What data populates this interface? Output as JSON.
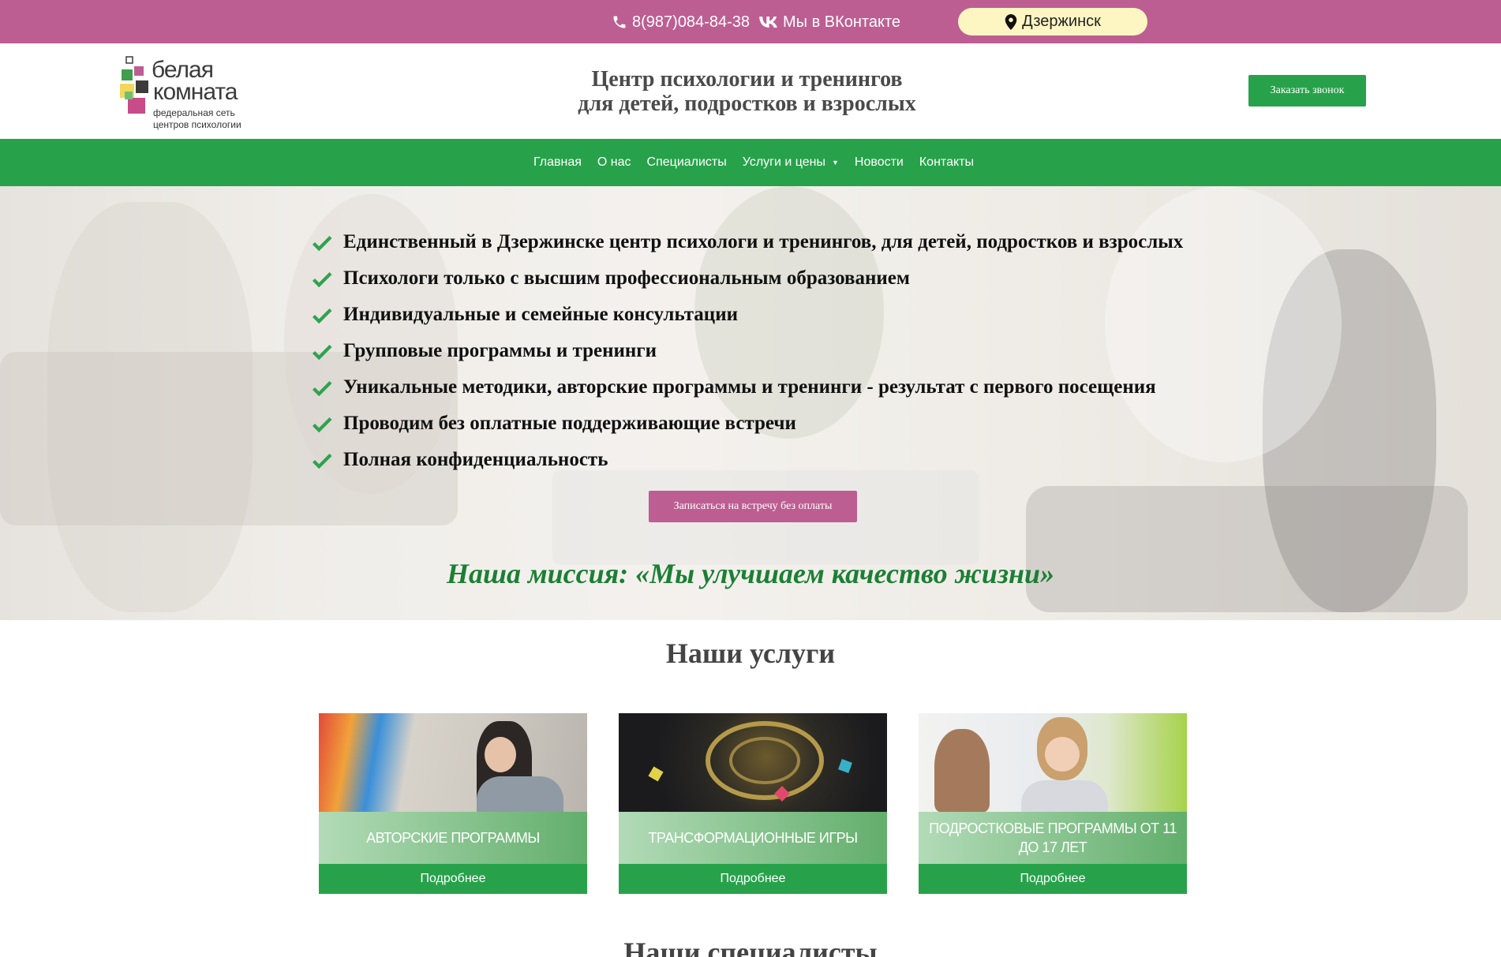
{
  "topbar": {
    "phone": "8(987)084-84-38",
    "vk_label": "Мы в ВКонтакте",
    "city": "Дзержинск",
    "icons": [
      "phone-icon",
      "vk-icon",
      "map-pin-icon"
    ]
  },
  "header": {
    "logo_line1": "белая",
    "logo_line2": "комната",
    "logo_sub1": "федеральная сеть",
    "logo_sub2": "центров психологии",
    "title_line1": "Центр психологии и тренингов",
    "title_line2": "для детей, подростков и взрослых",
    "call_button": "Заказать звонок"
  },
  "nav": {
    "items": [
      {
        "label": "Главная"
      },
      {
        "label": "О нас"
      },
      {
        "label": "Специалисты"
      },
      {
        "label": "Услуги и цены"
      },
      {
        "label": "Новости"
      },
      {
        "label": "Контакты"
      }
    ]
  },
  "hero": {
    "features": [
      "Единственный в Дзержинске центр психологи и тренингов, для детей, подростков и взрослых",
      "Психологи только с высшим профессиональным образованием",
      "Индивидуальные и семейные консультации",
      "Групповые программы и тренинги",
      "Уникальные методики, авторские программы и тренинги - результат с первого посещения",
      "Проводим без оплатные поддерживающие встречи",
      "Полная конфиденциальность"
    ],
    "button": "Записаться на встречу без оплаты",
    "mission": "Наша миссия: «Мы улучшаем качество жизни»"
  },
  "services": {
    "title": "Наши услуги",
    "cards": [
      {
        "label": "Авторские программы",
        "button": "Подробнее"
      },
      {
        "label": "Трансформационные игры",
        "button": "Подробнее"
      },
      {
        "label": "Подростковые программы от 11 до 17 лет",
        "button": "Подробнее"
      }
    ]
  },
  "specialists": {
    "title": "Наши специалисты"
  },
  "colors": {
    "brand_pink": "#bd5e92",
    "brand_green": "#27a24a",
    "city_pill": "#fdf6c3",
    "mission_green": "#1b7f35"
  }
}
